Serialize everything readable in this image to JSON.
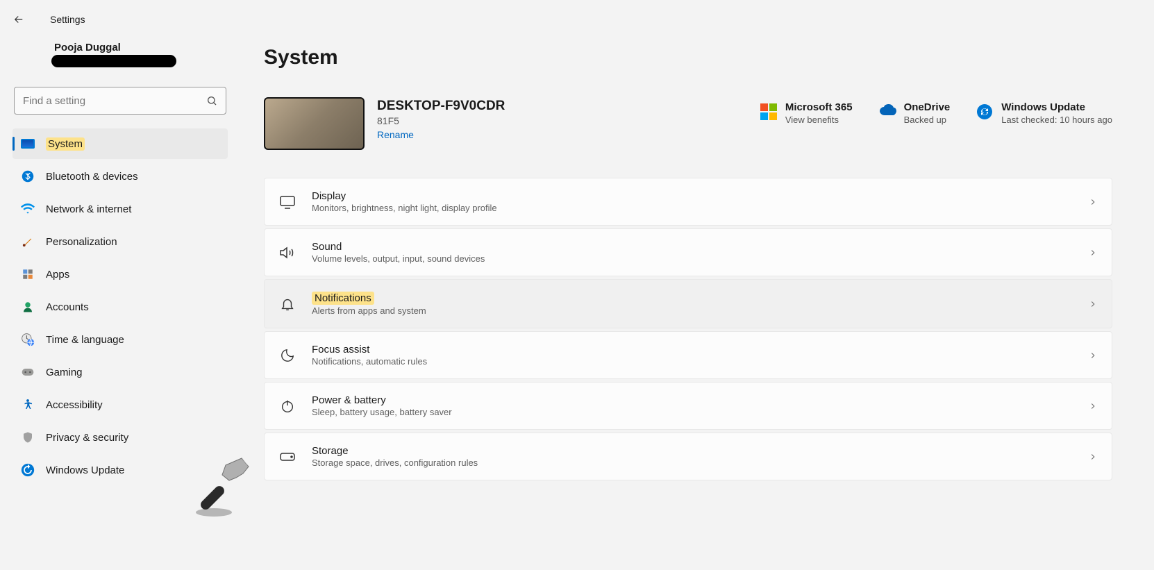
{
  "titlebar": {
    "label": "Settings"
  },
  "user": {
    "name": "Pooja Duggal"
  },
  "search": {
    "placeholder": "Find a setting"
  },
  "nav": [
    {
      "label": "System",
      "active": true,
      "highlight": true
    },
    {
      "label": "Bluetooth & devices"
    },
    {
      "label": "Network & internet"
    },
    {
      "label": "Personalization"
    },
    {
      "label": "Apps"
    },
    {
      "label": "Accounts"
    },
    {
      "label": "Time & language"
    },
    {
      "label": "Gaming"
    },
    {
      "label": "Accessibility"
    },
    {
      "label": "Privacy & security"
    },
    {
      "label": "Windows Update"
    }
  ],
  "page": {
    "title": "System",
    "device": {
      "name": "DESKTOP-F9V0CDR",
      "model": "81F5",
      "rename": "Rename"
    },
    "status": {
      "ms365": {
        "title": "Microsoft 365",
        "sub": "View benefits"
      },
      "onedrive": {
        "title": "OneDrive",
        "sub": "Backed up"
      },
      "update": {
        "title": "Windows Update",
        "sub": "Last checked: 10 hours ago"
      }
    },
    "items": [
      {
        "title": "Display",
        "sub": "Monitors, brightness, night light, display profile"
      },
      {
        "title": "Sound",
        "sub": "Volume levels, output, input, sound devices"
      },
      {
        "title": "Notifications",
        "sub": "Alerts from apps and system",
        "highlight": true
      },
      {
        "title": "Focus assist",
        "sub": "Notifications, automatic rules"
      },
      {
        "title": "Power & battery",
        "sub": "Sleep, battery usage, battery saver"
      },
      {
        "title": "Storage",
        "sub": "Storage space, drives, configuration rules"
      }
    ]
  }
}
